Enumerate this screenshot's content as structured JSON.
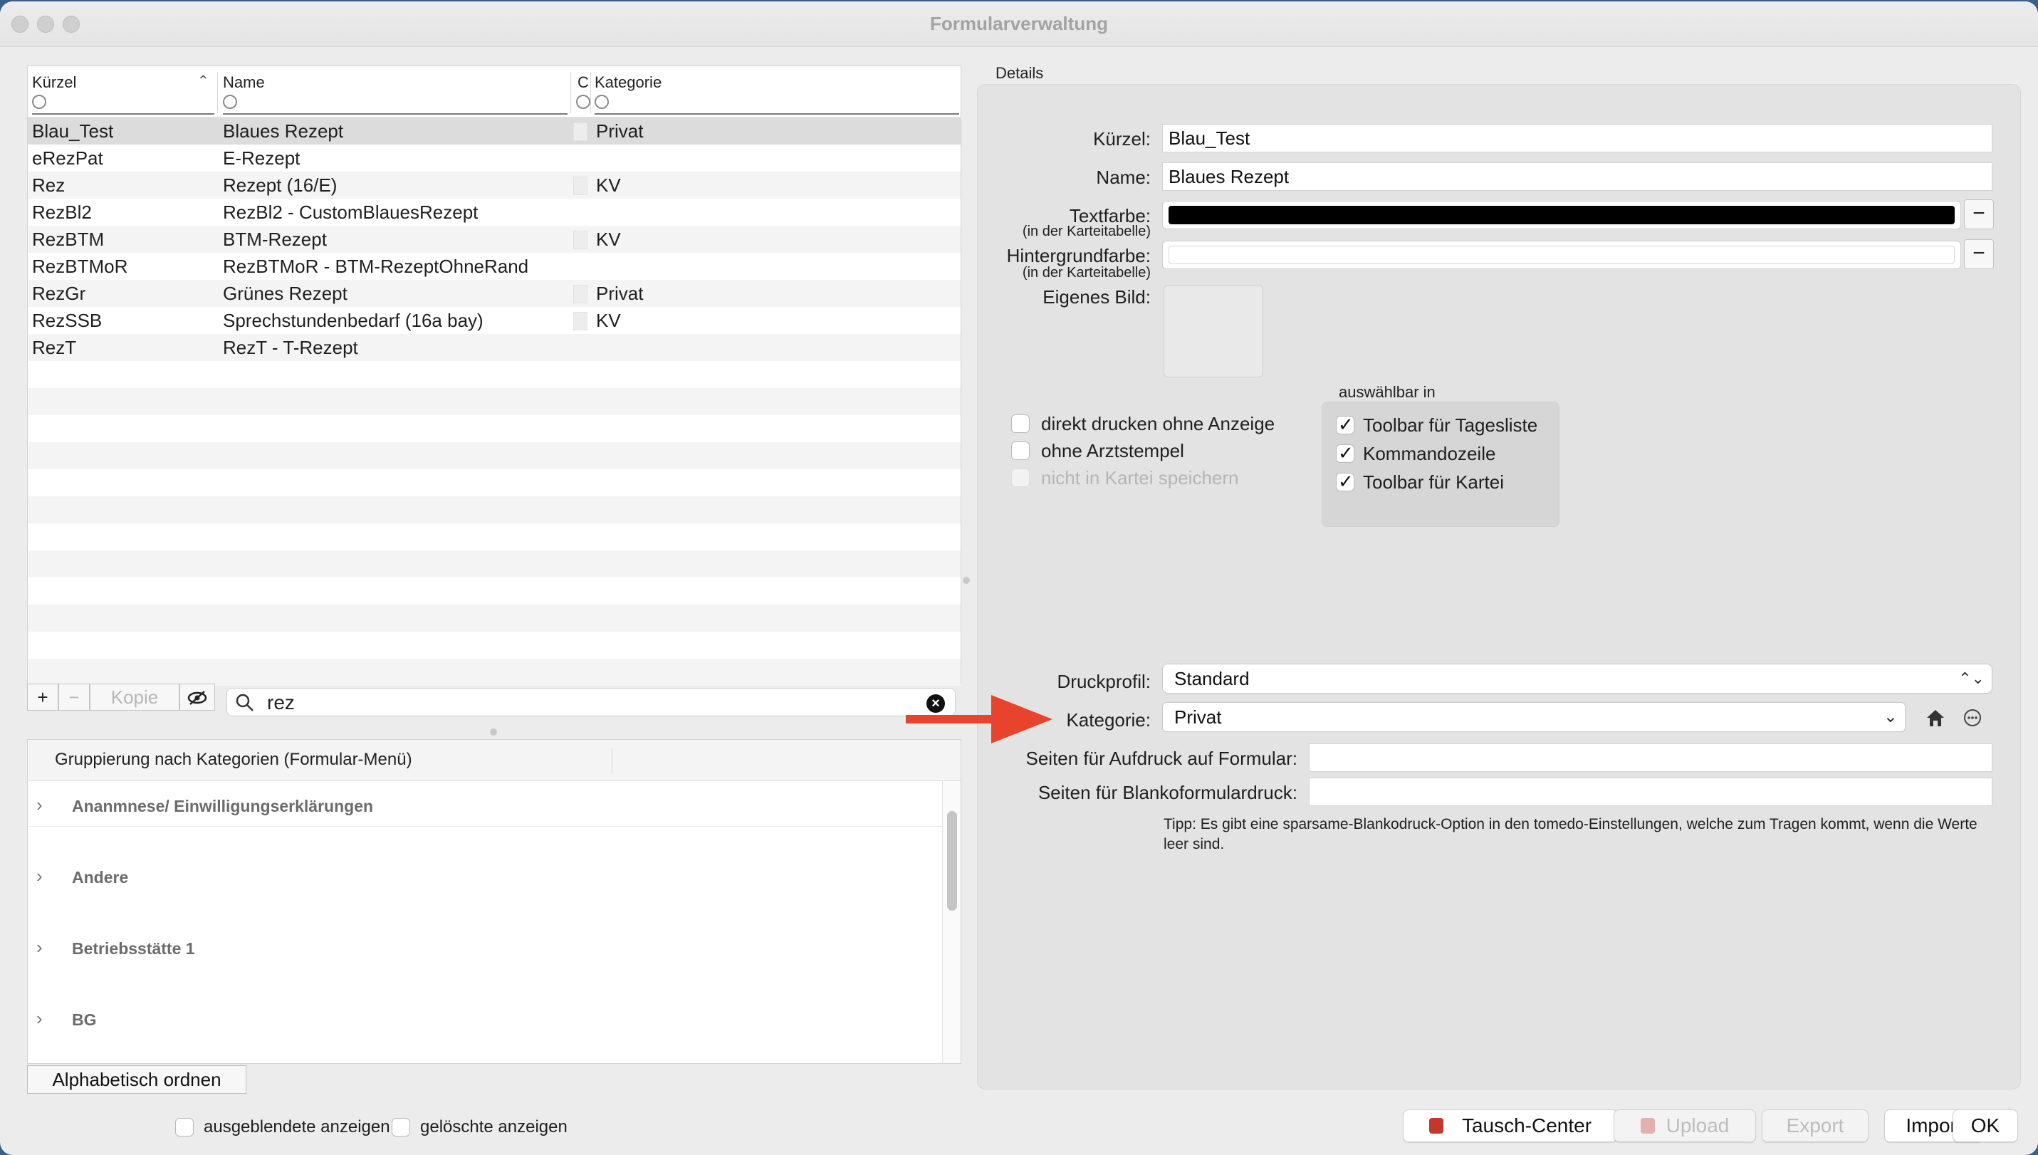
{
  "window": {
    "title": "Formularverwaltung"
  },
  "table": {
    "columns": {
      "kuerzel": "Kürzel",
      "name": "Name",
      "c": "C",
      "kategorie": "Kategorie"
    },
    "rows": [
      {
        "kuerzel": "Blau_Test",
        "name": "Blaues Rezept",
        "kategorie": "Privat",
        "selected": true
      },
      {
        "kuerzel": "eRezPat",
        "name": "E-Rezept",
        "kategorie": ""
      },
      {
        "kuerzel": "Rez",
        "name": "Rezept (16/E)",
        "kategorie": "KV"
      },
      {
        "kuerzel": "RezBl2",
        "name": "RezBl2 - CustomBlauesRezept",
        "kategorie": ""
      },
      {
        "kuerzel": "RezBTM",
        "name": "BTM-Rezept",
        "kategorie": "KV"
      },
      {
        "kuerzel": "RezBTMoR",
        "name": "RezBTMoR - BTM-RezeptOhneRand",
        "kategorie": ""
      },
      {
        "kuerzel": "RezGr",
        "name": "Grünes Rezept",
        "kategorie": "Privat"
      },
      {
        "kuerzel": "RezSSB",
        "name": "Sprechstundenbedarf (16a bay)",
        "kategorie": "KV"
      },
      {
        "kuerzel": "RezT",
        "name": "RezT - T-Rezept",
        "kategorie": ""
      }
    ],
    "empty_row_count": 12
  },
  "toolbar": {
    "add": "+",
    "remove": "−",
    "copy": "Kopie"
  },
  "search": {
    "value": "rez"
  },
  "grouping": {
    "header": "Gruppierung nach Kategorien (Formular-Menü)",
    "items": [
      "Ananmnese/ Einwilligungserklärungen",
      "Andere",
      "Betriebsstätte 1",
      "BG"
    ]
  },
  "alpha_button": "Alphabetisch ordnen",
  "show_hidden": {
    "label": "ausgeblendete anzeigen",
    "checked": false
  },
  "show_deleted": {
    "label": "gelöschte anzeigen",
    "checked": false
  },
  "details": {
    "title": "Details",
    "kuerzel_label": "Kürzel:",
    "kuerzel_value": "Blau_Test",
    "name_label": "Name:",
    "name_value": "Blaues Rezept",
    "textfarbe_label": "Textfarbe:",
    "textfarbe_sub": "(in der Karteitabelle)",
    "textfarbe_color": "#000000",
    "hintergrund_label": "Hintergrundfarbe:",
    "hintergrund_sub": "(in der Karteitabelle)",
    "hintergrund_color": "#ffffff",
    "bild_label": "Eigenes Bild:",
    "options": [
      {
        "label": "direkt drucken ohne Anzeige",
        "checked": false,
        "disabled": false
      },
      {
        "label": "ohne Arztstempel",
        "checked": false,
        "disabled": false
      },
      {
        "label": "nicht in Kartei speichern",
        "checked": false,
        "disabled": true
      }
    ],
    "auswaehlbar_title": "auswählbar in",
    "auswaehlbar": [
      {
        "label": "Toolbar für Tagesliste",
        "checked": true
      },
      {
        "label": "Kommandozeile",
        "checked": true
      },
      {
        "label": "Toolbar für Kartei",
        "checked": true
      }
    ],
    "druckprofil_label": "Druckprofil:",
    "druckprofil_value": "Standard",
    "kategorie_label": "Kategorie:",
    "kategorie_value": "Privat",
    "seiten_aufdruck_label": "Seiten für Aufdruck auf Formular:",
    "seiten_aufdruck_value": "",
    "seiten_blanko_label": "Seiten für Blankoformulardruck:",
    "seiten_blanko_value": "",
    "tip": "Tipp: Es gibt eine sparsame-Blankodruck-Option in den tomedo-Einstellungen, welche zum Tragen kommt, wenn die Werte leer sind."
  },
  "buttons": {
    "tausch": "Tausch-Center",
    "upload": "Upload",
    "export": "Export",
    "import": "Import",
    "ok": "OK"
  },
  "colors": {
    "annotation_arrow": "#e8432d",
    "selected_row": "#dcdcdc"
  }
}
